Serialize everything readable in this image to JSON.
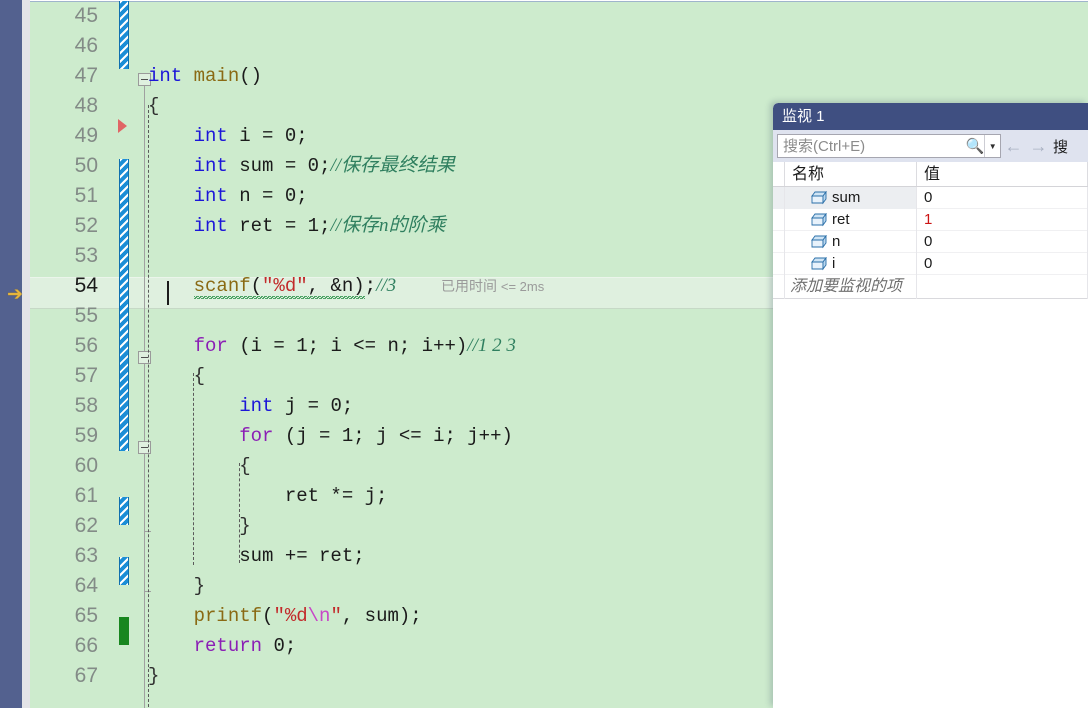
{
  "editor": {
    "language": "c",
    "background_color": "#cdebcd",
    "current_line": 54,
    "elapsed_label": "已用时间",
    "elapsed_value": "<= 2ms",
    "line_numbers": [
      "45",
      "46",
      "47",
      "48",
      "49",
      "50",
      "51",
      "52",
      "53",
      "54",
      "55",
      "56",
      "57",
      "58",
      "59",
      "60",
      "61",
      "62",
      "63",
      "64",
      "65",
      "66",
      "67"
    ],
    "lines": [
      {
        "num": "45",
        "tokens": []
      },
      {
        "num": "46",
        "tokens": []
      },
      {
        "num": "47",
        "tokens": [
          {
            "t": "int",
            "c": "kw"
          },
          {
            "t": " ",
            "c": "punc"
          },
          {
            "t": "main",
            "c": "fn"
          },
          {
            "t": "()",
            "c": "punc"
          }
        ]
      },
      {
        "num": "48",
        "tokens": [
          {
            "t": "{",
            "c": "brace"
          }
        ]
      },
      {
        "num": "49",
        "tokens": [
          {
            "t": "    ",
            "c": "punc"
          },
          {
            "t": "int",
            "c": "kw"
          },
          {
            "t": " i = ",
            "c": "punc"
          },
          {
            "t": "0",
            "c": "num"
          },
          {
            "t": ";",
            "c": "punc"
          }
        ]
      },
      {
        "num": "50",
        "tokens": [
          {
            "t": "    ",
            "c": "punc"
          },
          {
            "t": "int",
            "c": "kw"
          },
          {
            "t": " sum = ",
            "c": "punc"
          },
          {
            "t": "0",
            "c": "num"
          },
          {
            "t": ";",
            "c": "punc"
          },
          {
            "t": "//保存最终结果",
            "c": "cmt"
          }
        ]
      },
      {
        "num": "51",
        "tokens": [
          {
            "t": "    ",
            "c": "punc"
          },
          {
            "t": "int",
            "c": "kw"
          },
          {
            "t": " n = ",
            "c": "punc"
          },
          {
            "t": "0",
            "c": "num"
          },
          {
            "t": ";",
            "c": "punc"
          }
        ]
      },
      {
        "num": "52",
        "tokens": [
          {
            "t": "    ",
            "c": "punc"
          },
          {
            "t": "int",
            "c": "kw"
          },
          {
            "t": " ret = ",
            "c": "punc"
          },
          {
            "t": "1",
            "c": "num"
          },
          {
            "t": ";",
            "c": "punc"
          },
          {
            "t": "//保存n的阶乘",
            "c": "cmt"
          }
        ]
      },
      {
        "num": "53",
        "tokens": []
      },
      {
        "num": "54",
        "tokens": [
          {
            "t": "    ",
            "c": "punc"
          },
          {
            "t": "scanf",
            "c": "fn",
            "squiggle": true
          },
          {
            "t": "(",
            "c": "punc",
            "squiggle": true
          },
          {
            "t": "\"%d\"",
            "c": "str",
            "squiggle": true
          },
          {
            "t": ", ",
            "c": "punc",
            "squiggle": true
          },
          {
            "t": "&n",
            "c": "id",
            "squiggle": true
          },
          {
            "t": ")",
            "c": "punc",
            "squiggle": true
          },
          {
            "t": ";",
            "c": "punc"
          },
          {
            "t": "//3",
            "c": "cmt"
          }
        ]
      },
      {
        "num": "55",
        "tokens": []
      },
      {
        "num": "56",
        "tokens": [
          {
            "t": "    ",
            "c": "punc"
          },
          {
            "t": "for",
            "c": "kw2"
          },
          {
            "t": " (i = ",
            "c": "punc"
          },
          {
            "t": "1",
            "c": "num"
          },
          {
            "t": "; i <= n; i++)",
            "c": "punc"
          },
          {
            "t": "//1 2 3",
            "c": "cmt"
          }
        ]
      },
      {
        "num": "57",
        "tokens": [
          {
            "t": "    {",
            "c": "brace"
          }
        ]
      },
      {
        "num": "58",
        "tokens": [
          {
            "t": "        ",
            "c": "punc"
          },
          {
            "t": "int",
            "c": "kw"
          },
          {
            "t": " j = ",
            "c": "punc"
          },
          {
            "t": "0",
            "c": "num"
          },
          {
            "t": ";",
            "c": "punc"
          }
        ]
      },
      {
        "num": "59",
        "tokens": [
          {
            "t": "        ",
            "c": "punc"
          },
          {
            "t": "for",
            "c": "kw2"
          },
          {
            "t": " (j = ",
            "c": "punc"
          },
          {
            "t": "1",
            "c": "num"
          },
          {
            "t": "; j <= i; j++)",
            "c": "punc"
          }
        ]
      },
      {
        "num": "60",
        "tokens": [
          {
            "t": "        {",
            "c": "brace"
          }
        ]
      },
      {
        "num": "61",
        "tokens": [
          {
            "t": "            ret *= j;",
            "c": "punc"
          }
        ]
      },
      {
        "num": "62",
        "tokens": [
          {
            "t": "        }",
            "c": "brace"
          }
        ]
      },
      {
        "num": "63",
        "tokens": [
          {
            "t": "        sum += ret;",
            "c": "punc"
          }
        ]
      },
      {
        "num": "64",
        "tokens": [
          {
            "t": "    }",
            "c": "brace"
          }
        ]
      },
      {
        "num": "65",
        "tokens": [
          {
            "t": "    ",
            "c": "punc"
          },
          {
            "t": "printf",
            "c": "fn"
          },
          {
            "t": "(",
            "c": "punc"
          },
          {
            "t": "\"%d",
            "c": "str"
          },
          {
            "t": "\\n",
            "c": "esc"
          },
          {
            "t": "\"",
            "c": "str"
          },
          {
            "t": ", sum)",
            "c": "punc"
          },
          {
            "t": ";",
            "c": "punc"
          }
        ]
      },
      {
        "num": "66",
        "tokens": [
          {
            "t": "    ",
            "c": "punc"
          },
          {
            "t": "return",
            "c": "kw2"
          },
          {
            "t": " ",
            "c": "punc"
          },
          {
            "t": "0",
            "c": "num"
          },
          {
            "t": ";",
            "c": "punc"
          }
        ]
      },
      {
        "num": "67",
        "tokens": [
          {
            "t": "}",
            "c": "brace"
          }
        ]
      }
    ]
  },
  "watch": {
    "title": "监视 1",
    "search": {
      "placeholder": "搜索(Ctrl+E)",
      "value": ""
    },
    "toolbar": {
      "magnifier_icon": "search-icon",
      "dropdown_icon": "chevron-down-icon",
      "prev_icon": "arrow-left-icon",
      "next_icon": "arrow-right-icon",
      "truncated_label": "搜"
    },
    "columns": [
      "名称",
      "值"
    ],
    "rows": [
      {
        "name": "sum",
        "value": "0",
        "changed": false,
        "selected": true
      },
      {
        "name": "ret",
        "value": "1",
        "changed": true,
        "selected": false
      },
      {
        "name": "n",
        "value": "0",
        "changed": false,
        "selected": false
      },
      {
        "name": "i",
        "value": "0",
        "changed": false,
        "selected": false
      }
    ],
    "add_row_label": "添加要监视的项",
    "accent_title_color": "#3f4f81",
    "changed_value_color": "#cc1414"
  }
}
